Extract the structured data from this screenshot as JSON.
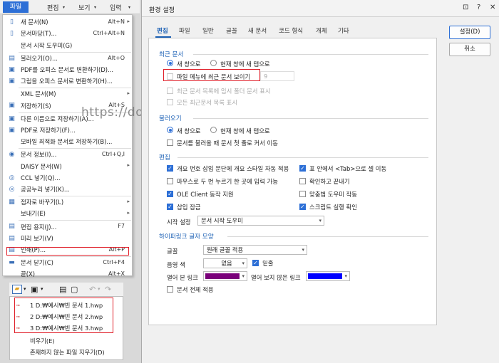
{
  "topbar": {
    "file": "파일",
    "edit": "편집",
    "view": "보기",
    "input": "입력"
  },
  "menu": [
    {
      "icon": "▯",
      "label": "새 문서(N)",
      "shortcut": "Alt+N",
      "arrow": "▸"
    },
    {
      "icon": "▯",
      "label": "문서마당(T)...",
      "shortcut": "Ctrl+Alt+N",
      "arrow": ""
    },
    {
      "icon": "",
      "label": "문서 시작 도우미(G)",
      "shortcut": "",
      "arrow": ""
    },
    {
      "icon": "▤",
      "label": "불러오기(O)...",
      "shortcut": "Alt+O",
      "arrow": ""
    },
    {
      "icon": "▣",
      "label": "PDF를 오피스 문서로 변환하기(D)...",
      "shortcut": "",
      "arrow": ""
    },
    {
      "icon": "▣",
      "label": "그림을 오피스 문서로 변환하기(H)...",
      "shortcut": "",
      "arrow": ""
    },
    {
      "icon": "",
      "label": "XML 문서(M)",
      "shortcut": "",
      "arrow": "▸"
    },
    {
      "icon": "▣",
      "label": "저장하기(S)",
      "shortcut": "Alt+S",
      "arrow": ""
    },
    {
      "icon": "▣",
      "label": "다른 이름으로 저장하기(A)...",
      "shortcut": "",
      "arrow": ""
    },
    {
      "icon": "▣",
      "label": "PDF로 저장하기(F)...",
      "shortcut": "",
      "arrow": ""
    },
    {
      "icon": "",
      "label": "모바일 최적화 문서로 저장하기(B)...",
      "shortcut": "",
      "arrow": ""
    },
    {
      "icon": "◉",
      "label": "문서 정보(I)...",
      "shortcut": "Ctrl+Q,I",
      "arrow": ""
    },
    {
      "icon": "",
      "label": "DAISY 문서(W)",
      "shortcut": "",
      "arrow": "▸"
    },
    {
      "icon": "◎",
      "label": "CCL 넣기(Q)...",
      "shortcut": "",
      "arrow": ""
    },
    {
      "icon": "◎",
      "label": "공공누리 넣기(K)...",
      "shortcut": "",
      "arrow": ""
    },
    {
      "icon": "▦",
      "label": "점자로 바꾸기(L)",
      "shortcut": "",
      "arrow": "▸"
    },
    {
      "icon": "",
      "label": "보내기(E)",
      "shortcut": "",
      "arrow": "▸"
    },
    {
      "icon": "▤",
      "label": "편집 용지(J)...",
      "shortcut": "F7",
      "arrow": ""
    },
    {
      "icon": "▤",
      "label": "미리 보기(V)",
      "shortcut": "",
      "arrow": ""
    },
    {
      "icon": "▤",
      "label": "인쇄(P)...",
      "shortcut": "Alt+P",
      "arrow": ""
    },
    {
      "icon": "▬",
      "label": "문서 닫기(C)",
      "shortcut": "Ctrl+F4",
      "arrow": ""
    },
    {
      "icon": "",
      "label": "끝(X)",
      "shortcut": "Alt+X",
      "arrow": ""
    }
  ],
  "watermark": "https://dolpali.tistory.com",
  "recent_files": {
    "items": [
      "1 D:₩예시₩빈 문서 1.hwp",
      "2 D:₩예시₩빈 문서 2.hwp",
      "3 D:₩예시₩빈 문서 3.hwp"
    ],
    "clear": "비우기(E)",
    "remove_missing": "존재하지 않는 파일 지우기(D)"
  },
  "dialog": {
    "title": "환경 설정",
    "title_buttons": [
      "⊡",
      "?",
      "✕"
    ],
    "ok": "설정(D)",
    "cancel": "취소",
    "tabs": [
      "편집",
      "파일",
      "일반",
      "글꼴",
      "새 문서",
      "코드 형식",
      "개체",
      "기타"
    ],
    "recent": {
      "section": "최근 문서",
      "radio_new_window": "새 창으로",
      "radio_new_tab": "현재 창에 새 탭으로",
      "show_in_menu": "파일 메뉴에 최근 문서 보이기",
      "count": "9",
      "temp_folder": "최근 문서 목록에 임시 폴더 문서 표시",
      "all_show": "모든 최근문서 목록 표시"
    },
    "open": {
      "section": "불러오기",
      "radio_new_window": "새 창으로",
      "radio_new_tab": "현재 창에 새 탭으로",
      "first_cursor": "문서를 불러올 때 문서 첫 줄로 커서 이동"
    },
    "edit": {
      "section": "편집",
      "o1": "개요 번호 삽입 문단에 개요 스타일 자동 적용",
      "o2": "표 안에서 <Tab>으로 셀 이동",
      "o3": "마우스로 두 번 누르기 한 곳에 입력 가능",
      "o4": "확인하고 끝내기",
      "o5": "OLE Client 동작 지원",
      "o6": "맞춤법 도우미 작동",
      "o7": "삽입 잠금",
      "o8": "스크립트 실행 확인",
      "start_label": "시작 설정",
      "start_value": "문서 시작 도우미"
    },
    "link": {
      "section": "하이퍼링크 글자 모양",
      "font_label": "글꼴",
      "font_value": "원래 글꼴 적용",
      "shade_label": "음영 색",
      "shade_value": "없음",
      "underline": "밑줄",
      "visited_label": "열어 본 링크",
      "unvisited_label": "열어 보지 않은 링크",
      "whole": "문서 전체 적용"
    }
  },
  "colors": {
    "visited": "#7a007a",
    "unvisited": "#0000ff",
    "highlight": "#e0202a",
    "accent": "#2d6fd6"
  }
}
